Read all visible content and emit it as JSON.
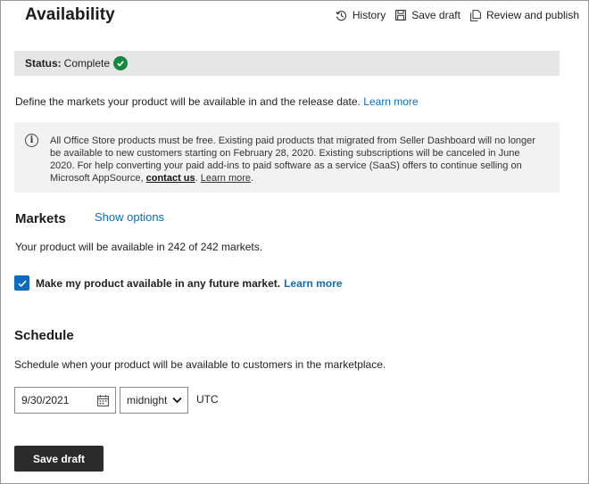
{
  "header": {
    "title": "Availability",
    "actions": [
      {
        "label": "History",
        "icon": "history-icon"
      },
      {
        "label": "Save draft",
        "icon": "save-icon"
      },
      {
        "label": "Review and publish",
        "icon": "publish-icon"
      }
    ]
  },
  "status": {
    "label": "Status:",
    "value": "Complete",
    "color": "#128a3e"
  },
  "intro": {
    "text": "Define the markets your product will be available in and the release date.",
    "link": "Learn more"
  },
  "notice": {
    "text": "All Office Store products must be free. Existing paid products that migrated from Seller Dashboard will no longer be available to new customers starting on February 28, 2020. Existing subscriptions will be canceled in June 2020. For help converting your paid add-ins to paid software as a service (SaaS) offers to continue selling on Microsoft AppSource,",
    "contact_link": "contact us",
    "separator": ".",
    "learn_link": "Learn more",
    "end": "."
  },
  "markets": {
    "heading": "Markets",
    "show_options": "Show options",
    "availability_text": "Your product will be available in 242 of 242 markets.",
    "future_market_label": "Make my product available in any future market.",
    "future_market_link": "Learn more",
    "future_market_checked": true
  },
  "schedule": {
    "heading": "Schedule",
    "description": "Schedule when your product will be available to customers in the marketplace.",
    "date_value": "9/30/2021",
    "time_value": "midnight",
    "timezone": "UTC"
  },
  "footer": {
    "save_label": "Save draft"
  },
  "colors": {
    "accent": "#0f6cbd",
    "button_bg": "#2b2b2b",
    "status_bg": "#e6e6e6",
    "notice_bg": "#f2f2f2"
  }
}
